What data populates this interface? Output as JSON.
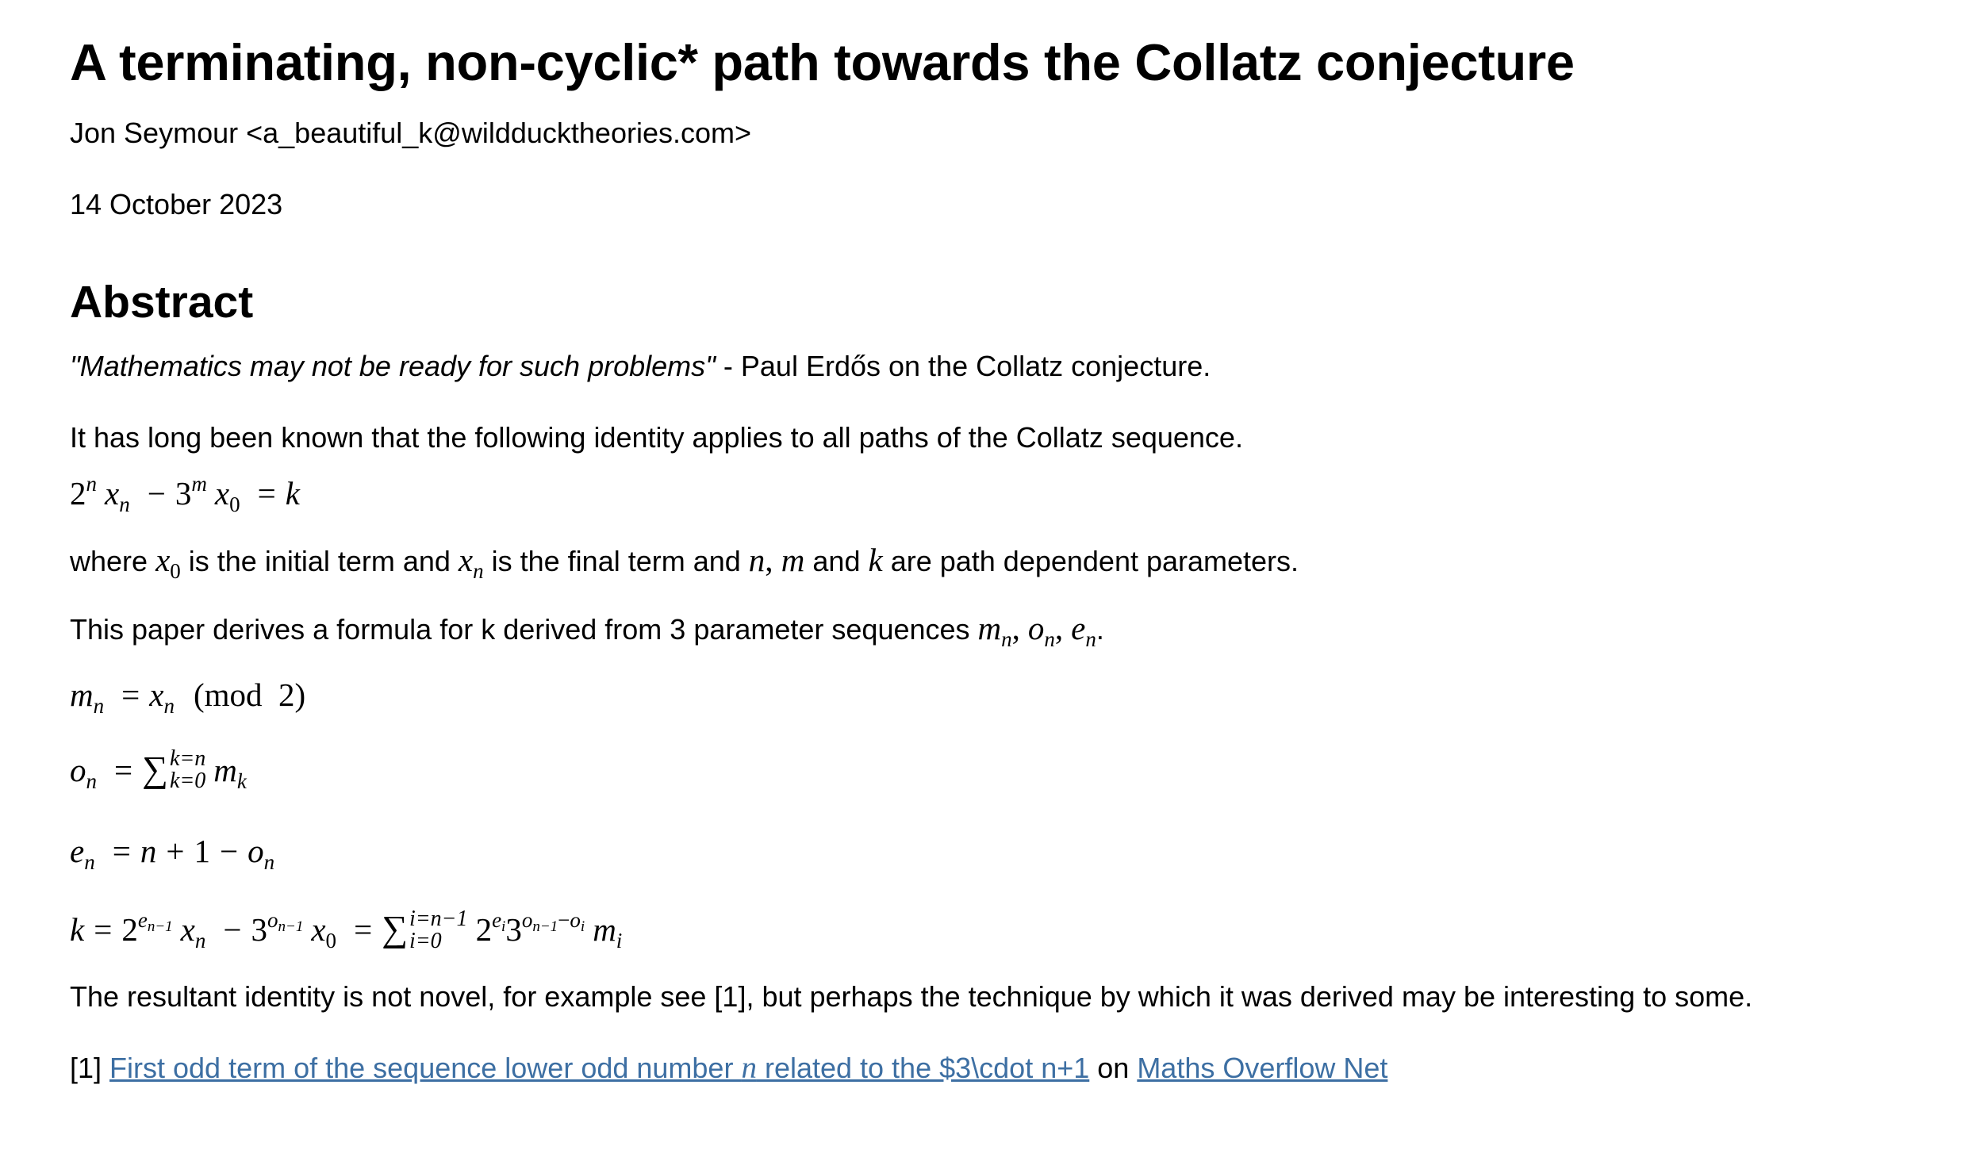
{
  "document": {
    "title": "A terminating, non-cyclic* path towards the Collatz conjecture",
    "author": "Jon Seymour <a_beautiful_k@wildducktheories.com>",
    "date": "14 October 2023"
  },
  "abstract": {
    "heading": "Abstract",
    "quote": "\"Mathematics may not be ready for such problems\"",
    "quote_attribution": " - Paul Erdős on the Collatz conjecture.",
    "intro": "It has long been known that the following identity applies to all paths of the Collatz sequence.",
    "where_parts": [
      "where ",
      " is the initial term and ",
      " is the final term and ",
      ", ",
      " and ",
      " are path dependent parameters."
    ],
    "derives_text": "This paper derives a formula for k derived from 3 parameter sequences ",
    "derives_end": ".",
    "resultant": "The resultant identity is not novel, for example see [1], but perhaps the technique by which it was derived may be interesting to some.",
    "reference": {
      "marker": "[1] ",
      "link_part1": "First odd term of the sequence lower odd number ",
      "link_var": "n",
      "link_part2": " related to the $3\\cdot n+1",
      "on_text": " on ",
      "source_link": "Maths Overflow Net"
    }
  },
  "math": {
    "two": "2",
    "three": "3",
    "zero": "0",
    "one": "1",
    "n": "n",
    "m": "m",
    "k": "k",
    "x": "x",
    "o": "o",
    "e": "e",
    "i": "i",
    "eq": "=",
    "minus": "−",
    "plus": "+",
    "comma": ",",
    "mod": "(mod  2)",
    "sigma": "∑",
    "k_eq_n": "k=n",
    "k_eq_0": "k=0",
    "i_eq_n_minus_1": "i=n−1",
    "i_eq_0": "i=0",
    "n_minus_1": "n−1",
    "exp_o_rest": "−1−",
    "sub_n_minus": "n−1"
  }
}
